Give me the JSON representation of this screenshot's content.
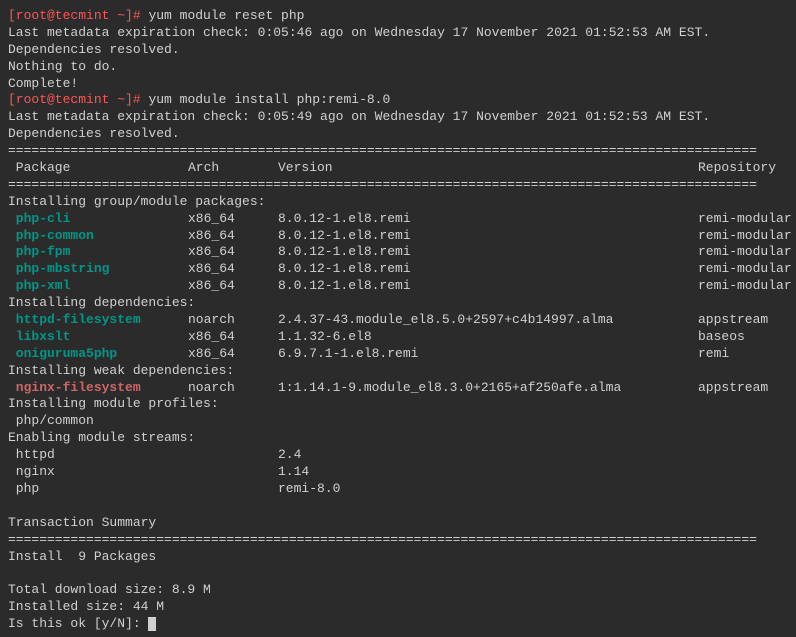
{
  "prompt1": {
    "user_host": "[root@tecmint ~]# ",
    "command": "yum module reset php"
  },
  "reset_output": {
    "metadata": "Last metadata expiration check: 0:05:46 ago on Wednesday 17 November 2021 01:52:53 AM EST.",
    "deps": "Dependencies resolved.",
    "nothing": "Nothing to do.",
    "complete": "Complete!"
  },
  "prompt2": {
    "user_host": "[root@tecmint ~]# ",
    "command": "yum module install php:remi-8.0"
  },
  "install_output": {
    "metadata": "Last metadata expiration check: 0:05:49 ago on Wednesday 17 November 2021 01:52:53 AM EST.",
    "deps": "Dependencies resolved."
  },
  "sep1": "================================================================================================",
  "sep2": "================================================================================================",
  "header": {
    "package": " Package",
    "arch": "Arch",
    "version": "Version",
    "repository": "Repository"
  },
  "section_group": "Installing group/module packages:",
  "group_packages": [
    {
      "name": " php-cli",
      "arch": "x86_64",
      "version": "8.0.12-1.el8.remi",
      "repo": "remi-modular"
    },
    {
      "name": " php-common",
      "arch": "x86_64",
      "version": "8.0.12-1.el8.remi",
      "repo": "remi-modular"
    },
    {
      "name": " php-fpm",
      "arch": "x86_64",
      "version": "8.0.12-1.el8.remi",
      "repo": "remi-modular"
    },
    {
      "name": " php-mbstring",
      "arch": "x86_64",
      "version": "8.0.12-1.el8.remi",
      "repo": "remi-modular"
    },
    {
      "name": " php-xml",
      "arch": "x86_64",
      "version": "8.0.12-1.el8.remi",
      "repo": "remi-modular"
    }
  ],
  "section_deps": "Installing dependencies:",
  "dep_packages": [
    {
      "name": " httpd-filesystem",
      "arch": "noarch",
      "version": "2.4.37-43.module_el8.5.0+2597+c4b14997.alma",
      "repo": "appstream"
    },
    {
      "name": " libxslt",
      "arch": "x86_64",
      "version": "1.1.32-6.el8",
      "repo": "baseos"
    },
    {
      "name": " oniguruma5php",
      "arch": "x86_64",
      "version": "6.9.7.1-1.el8.remi",
      "repo": "remi"
    }
  ],
  "section_weak": "Installing weak dependencies:",
  "weak_packages": [
    {
      "name": " nginx-filesystem",
      "arch": "noarch",
      "version": "1:1.14.1-9.module_el8.3.0+2165+af250afe.alma",
      "repo": "appstream"
    }
  ],
  "section_profiles": "Installing module profiles:",
  "profile": " php/common",
  "section_streams": "Enabling module streams:",
  "streams": [
    {
      "name": " httpd",
      "version": "2.4"
    },
    {
      "name": " nginx",
      "version": "1.14"
    },
    {
      "name": " php",
      "version": "remi-8.0"
    }
  ],
  "transaction": "Transaction Summary",
  "sep3": "================================================================================================",
  "install_count": "Install  9 Packages",
  "download_size": "Total download size: 8.9 M",
  "installed_size": "Installed size: 44 M",
  "confirm": "Is this ok [y/N]: "
}
